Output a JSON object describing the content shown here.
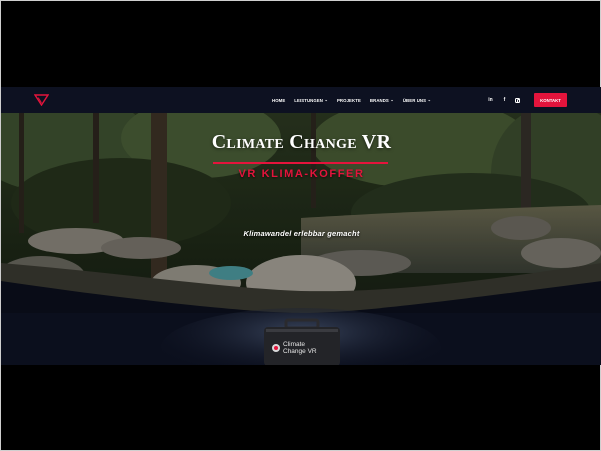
{
  "nav": {
    "logo_icon": "triangle-logo-icon",
    "items": [
      {
        "label": "HOME",
        "dropdown": false
      },
      {
        "label": "LEISTUNGEN",
        "dropdown": true
      },
      {
        "label": "PROJEKTE",
        "dropdown": false
      },
      {
        "label": "BRANDS",
        "dropdown": true
      },
      {
        "label": "ÜBER UNS",
        "dropdown": true
      }
    ],
    "social": [
      "linkedin-icon",
      "facebook-icon",
      "instagram-icon"
    ],
    "social_glyphs": {
      "linkedin": "in",
      "facebook": "f"
    },
    "cta_label": "KONTAKT"
  },
  "hero": {
    "title": "Climate Change VR",
    "subtitle": "VR KLIMA-KOFFER",
    "tagline": "Klimawandel erlebbar gemacht",
    "case_label_line1": "Climate",
    "case_label_line2": "Change VR"
  },
  "colors": {
    "accent": "#e4143c",
    "nav_bg": "#0d1121",
    "page_bg": "#0b0f1d"
  }
}
